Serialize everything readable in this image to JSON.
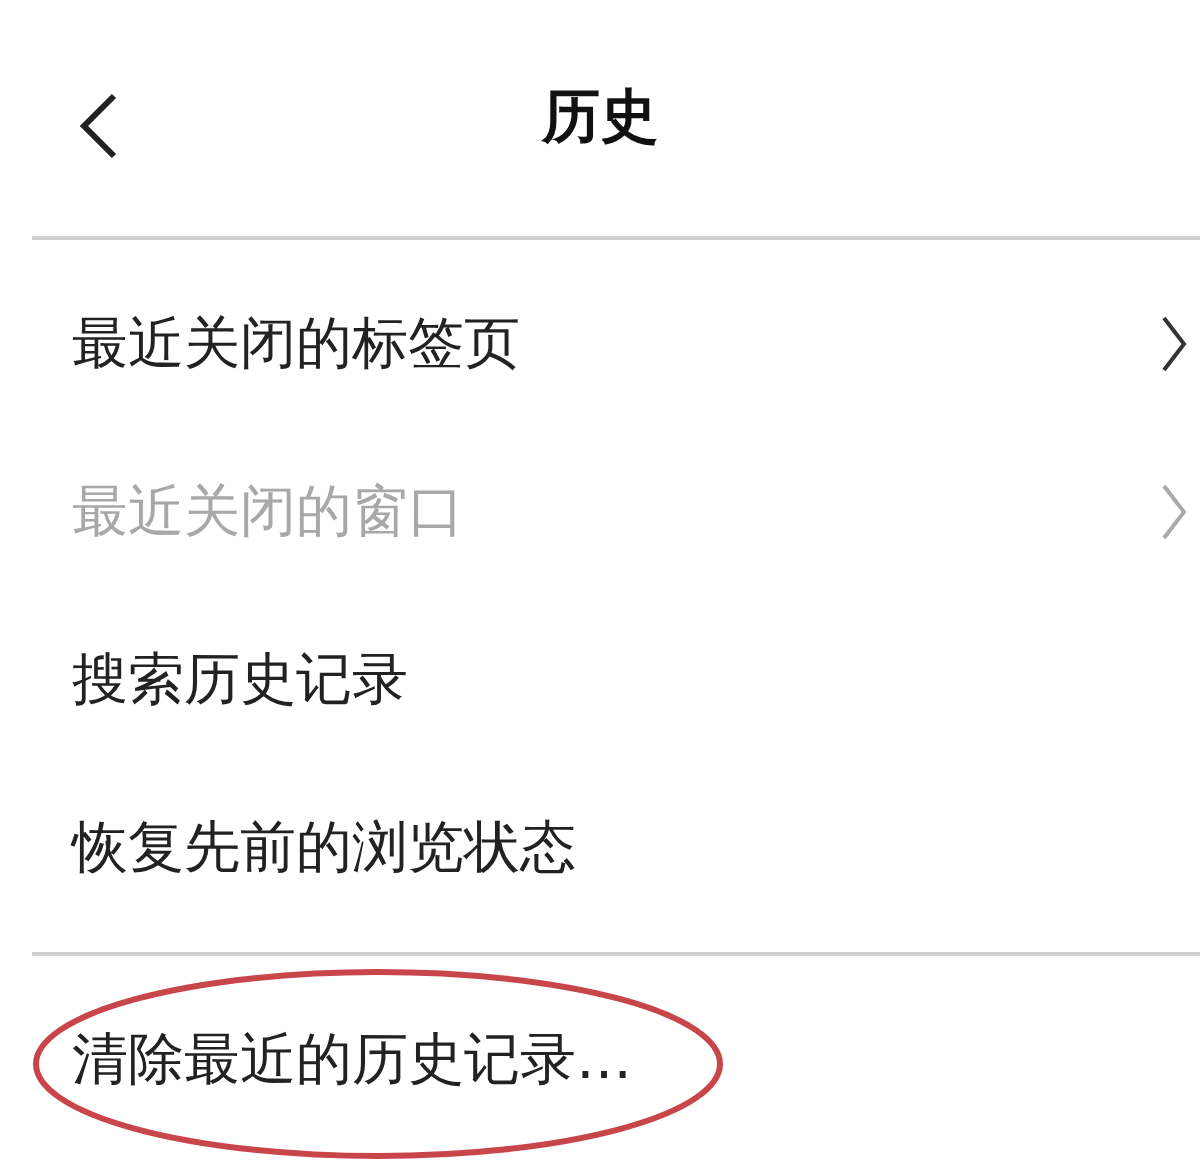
{
  "header": {
    "title": "历史"
  },
  "groups": [
    {
      "items": [
        {
          "label": "最近关闭的标签页",
          "disabled": false,
          "submenu": true,
          "circled": false
        },
        {
          "label": "最近关闭的窗口",
          "disabled": true,
          "submenu": true,
          "circled": false
        },
        {
          "label": "搜索历史记录",
          "disabled": false,
          "submenu": false,
          "circled": false
        },
        {
          "label": "恢复先前的浏览状态",
          "disabled": false,
          "submenu": false,
          "circled": false
        }
      ]
    },
    {
      "items": [
        {
          "label": "清除最近的历史记录…",
          "disabled": false,
          "submenu": false,
          "circled": true
        }
      ]
    }
  ]
}
